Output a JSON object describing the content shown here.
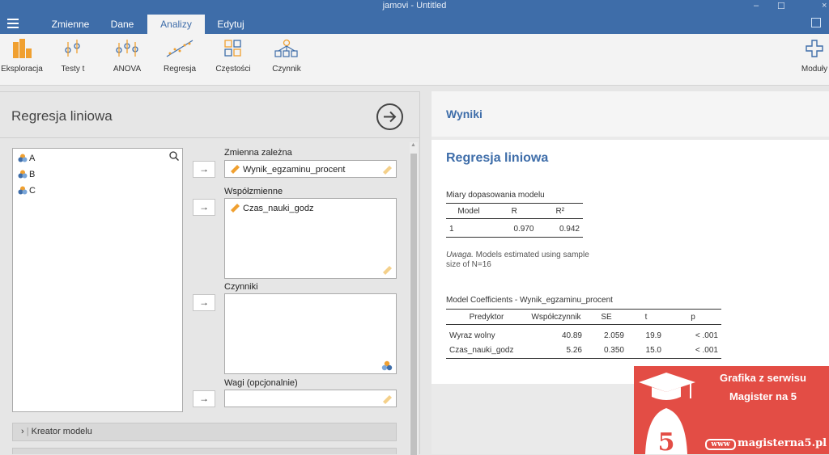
{
  "window": {
    "title": "jamovi - Untitled",
    "minimize": "–",
    "maximize": "☐",
    "close": "×"
  },
  "tabs": [
    {
      "label": "Zmienne"
    },
    {
      "label": "Dane"
    },
    {
      "label": "Analizy"
    },
    {
      "label": "Edytuj"
    }
  ],
  "ribbon": {
    "items": [
      {
        "label": "Eksploracja",
        "icon": "exploration-icon"
      },
      {
        "label": "Testy t",
        "icon": "ttest-icon"
      },
      {
        "label": "ANOVA",
        "icon": "anova-icon"
      },
      {
        "label": "Regresja",
        "icon": "regression-icon"
      },
      {
        "label": "Częstości",
        "icon": "frequencies-icon"
      },
      {
        "label": "Czynnik",
        "icon": "factor-icon"
      }
    ],
    "modules": "Moduły"
  },
  "left": {
    "title": "Regresja liniowa",
    "variables": [
      "A",
      "B",
      "C"
    ],
    "dependent_label": "Zmienna zależna",
    "dependent_value": "Wynik_egzaminu_procent",
    "covariates_label": "Współzmienne",
    "covariates_value": "Czas_nauki_godz",
    "factors_label": "Czynniki",
    "weights_label": "Wagi (opcjonalnie)",
    "section1": "Kreator modelu",
    "arrow": "→",
    "chevron": "›"
  },
  "results": {
    "header": "Wyniki",
    "title": "Regresja liniowa",
    "fit": {
      "title": "Miary dopasowania modelu",
      "headers": [
        "Model",
        "R",
        "R²"
      ],
      "rows": [
        [
          "1",
          "0.970",
          "0.942"
        ]
      ],
      "note_italic": "Uwaga.",
      "note_text": " Models estimated using sample size of N=16"
    },
    "coef": {
      "title": "Model Coefficients - Wynik_egzaminu_procent",
      "headers": [
        "Predyktor",
        "Współczynnik",
        "SE",
        "t",
        "p"
      ],
      "rows": [
        [
          "Wyraz wolny",
          "40.89",
          "2.059",
          "19.9",
          "< .001"
        ],
        [
          "Czas_nauki_godz",
          "5.26",
          "0.350",
          "15.0",
          "< .001"
        ]
      ]
    }
  },
  "badge": {
    "line1": "Grafika z serwisu",
    "line2": "Magister na 5",
    "digit": "5",
    "www": "www",
    "url": "magisterna5.pl"
  },
  "colors": {
    "accent": "#3e6da9",
    "badge": "#e34d45"
  }
}
